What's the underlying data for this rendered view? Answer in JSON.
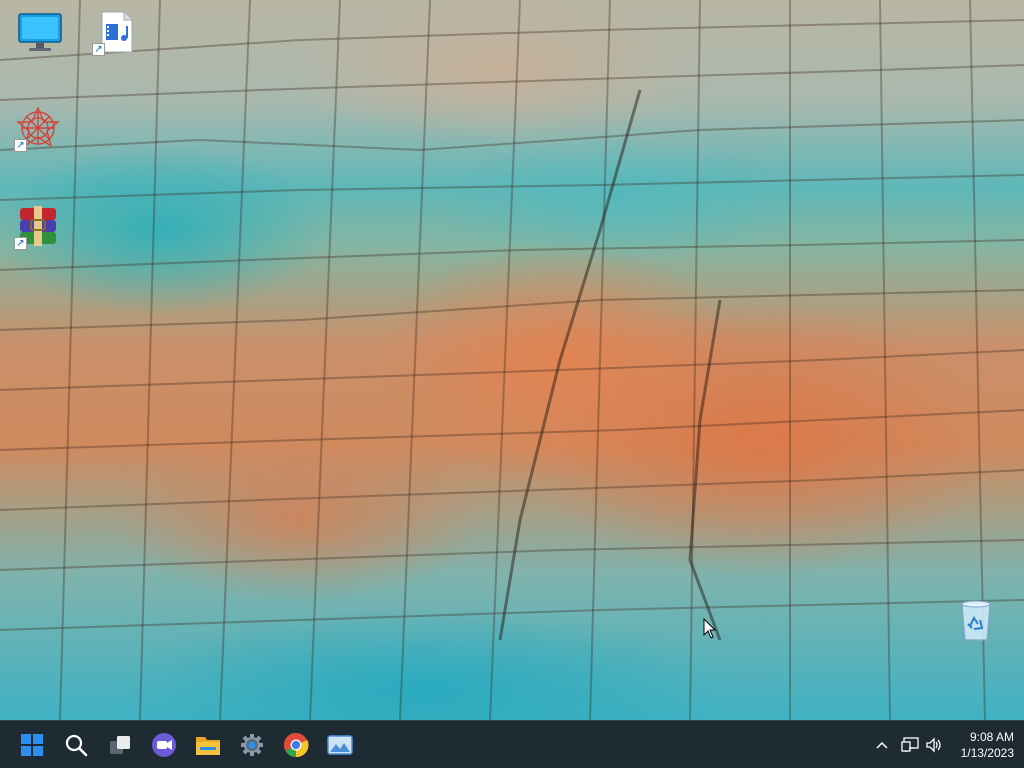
{
  "desktop": {
    "wallpaper": "aerial-cracked-stone-shoreline",
    "icons": [
      {
        "name": "this-pc-icon",
        "shortcut": false
      },
      {
        "name": "media-file-icon",
        "shortcut": true
      },
      {
        "name": "app-shortcut-icon",
        "shortcut": true
      },
      {
        "name": "winrar-icon",
        "shortcut": true
      },
      {
        "name": "recycle-bin-icon",
        "shortcut": false
      }
    ]
  },
  "taskbar": {
    "background": "#1f2b33",
    "pinned": [
      {
        "name": "start-icon",
        "color": "#2b8ef0"
      },
      {
        "name": "search-icon",
        "color": "#ffffff"
      },
      {
        "name": "task-view-icon",
        "color": "#ffffff"
      },
      {
        "name": "chat-icon",
        "color": "#6b5bd8"
      },
      {
        "name": "file-explorer-icon",
        "color": "#f5c33b"
      },
      {
        "name": "settings-icon",
        "color": "#8a9aa8"
      },
      {
        "name": "chrome-icon",
        "color": "#e04b3a"
      },
      {
        "name": "image-viewer-icon",
        "color": "#4a8fd8"
      }
    ],
    "tray": {
      "icons": [
        "chevron-up-icon",
        "network-icon",
        "volume-icon"
      ]
    },
    "clock": {
      "time": "9:08 AM",
      "date": "1/13/2023"
    }
  }
}
